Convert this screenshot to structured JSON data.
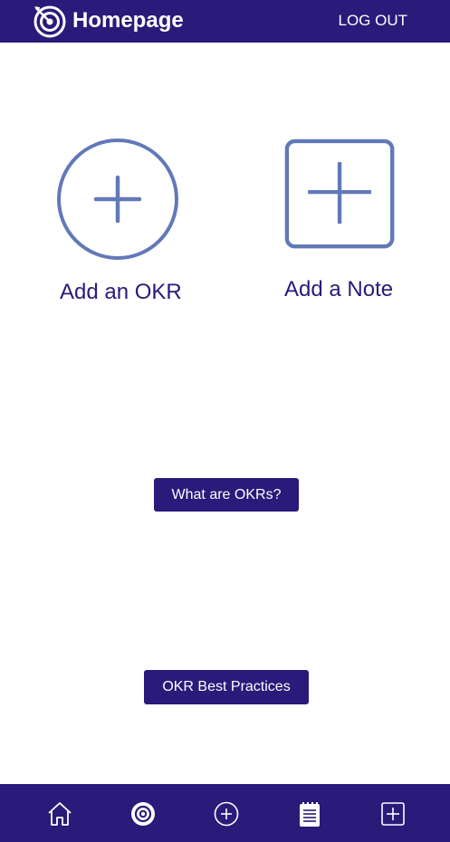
{
  "header": {
    "title": "Homepage",
    "logout_label": "LOG OUT",
    "logo_icon": "target-arrow-icon"
  },
  "actions": {
    "add_okr_label": "Add an OKR",
    "add_note_label": "Add a Note"
  },
  "buttons": {
    "what_are_okrs": "What are OKRs?",
    "okr_best_practices": "OKR Best Practices"
  },
  "bottom_nav": [
    {
      "icon": "home-icon"
    },
    {
      "icon": "target-icon"
    },
    {
      "icon": "add-circle-icon"
    },
    {
      "icon": "notepad-icon"
    },
    {
      "icon": "add-square-icon"
    }
  ],
  "colors": {
    "primary": "#2a1a7a",
    "icon_accent": "#6279b8",
    "background": "#ffffff"
  }
}
